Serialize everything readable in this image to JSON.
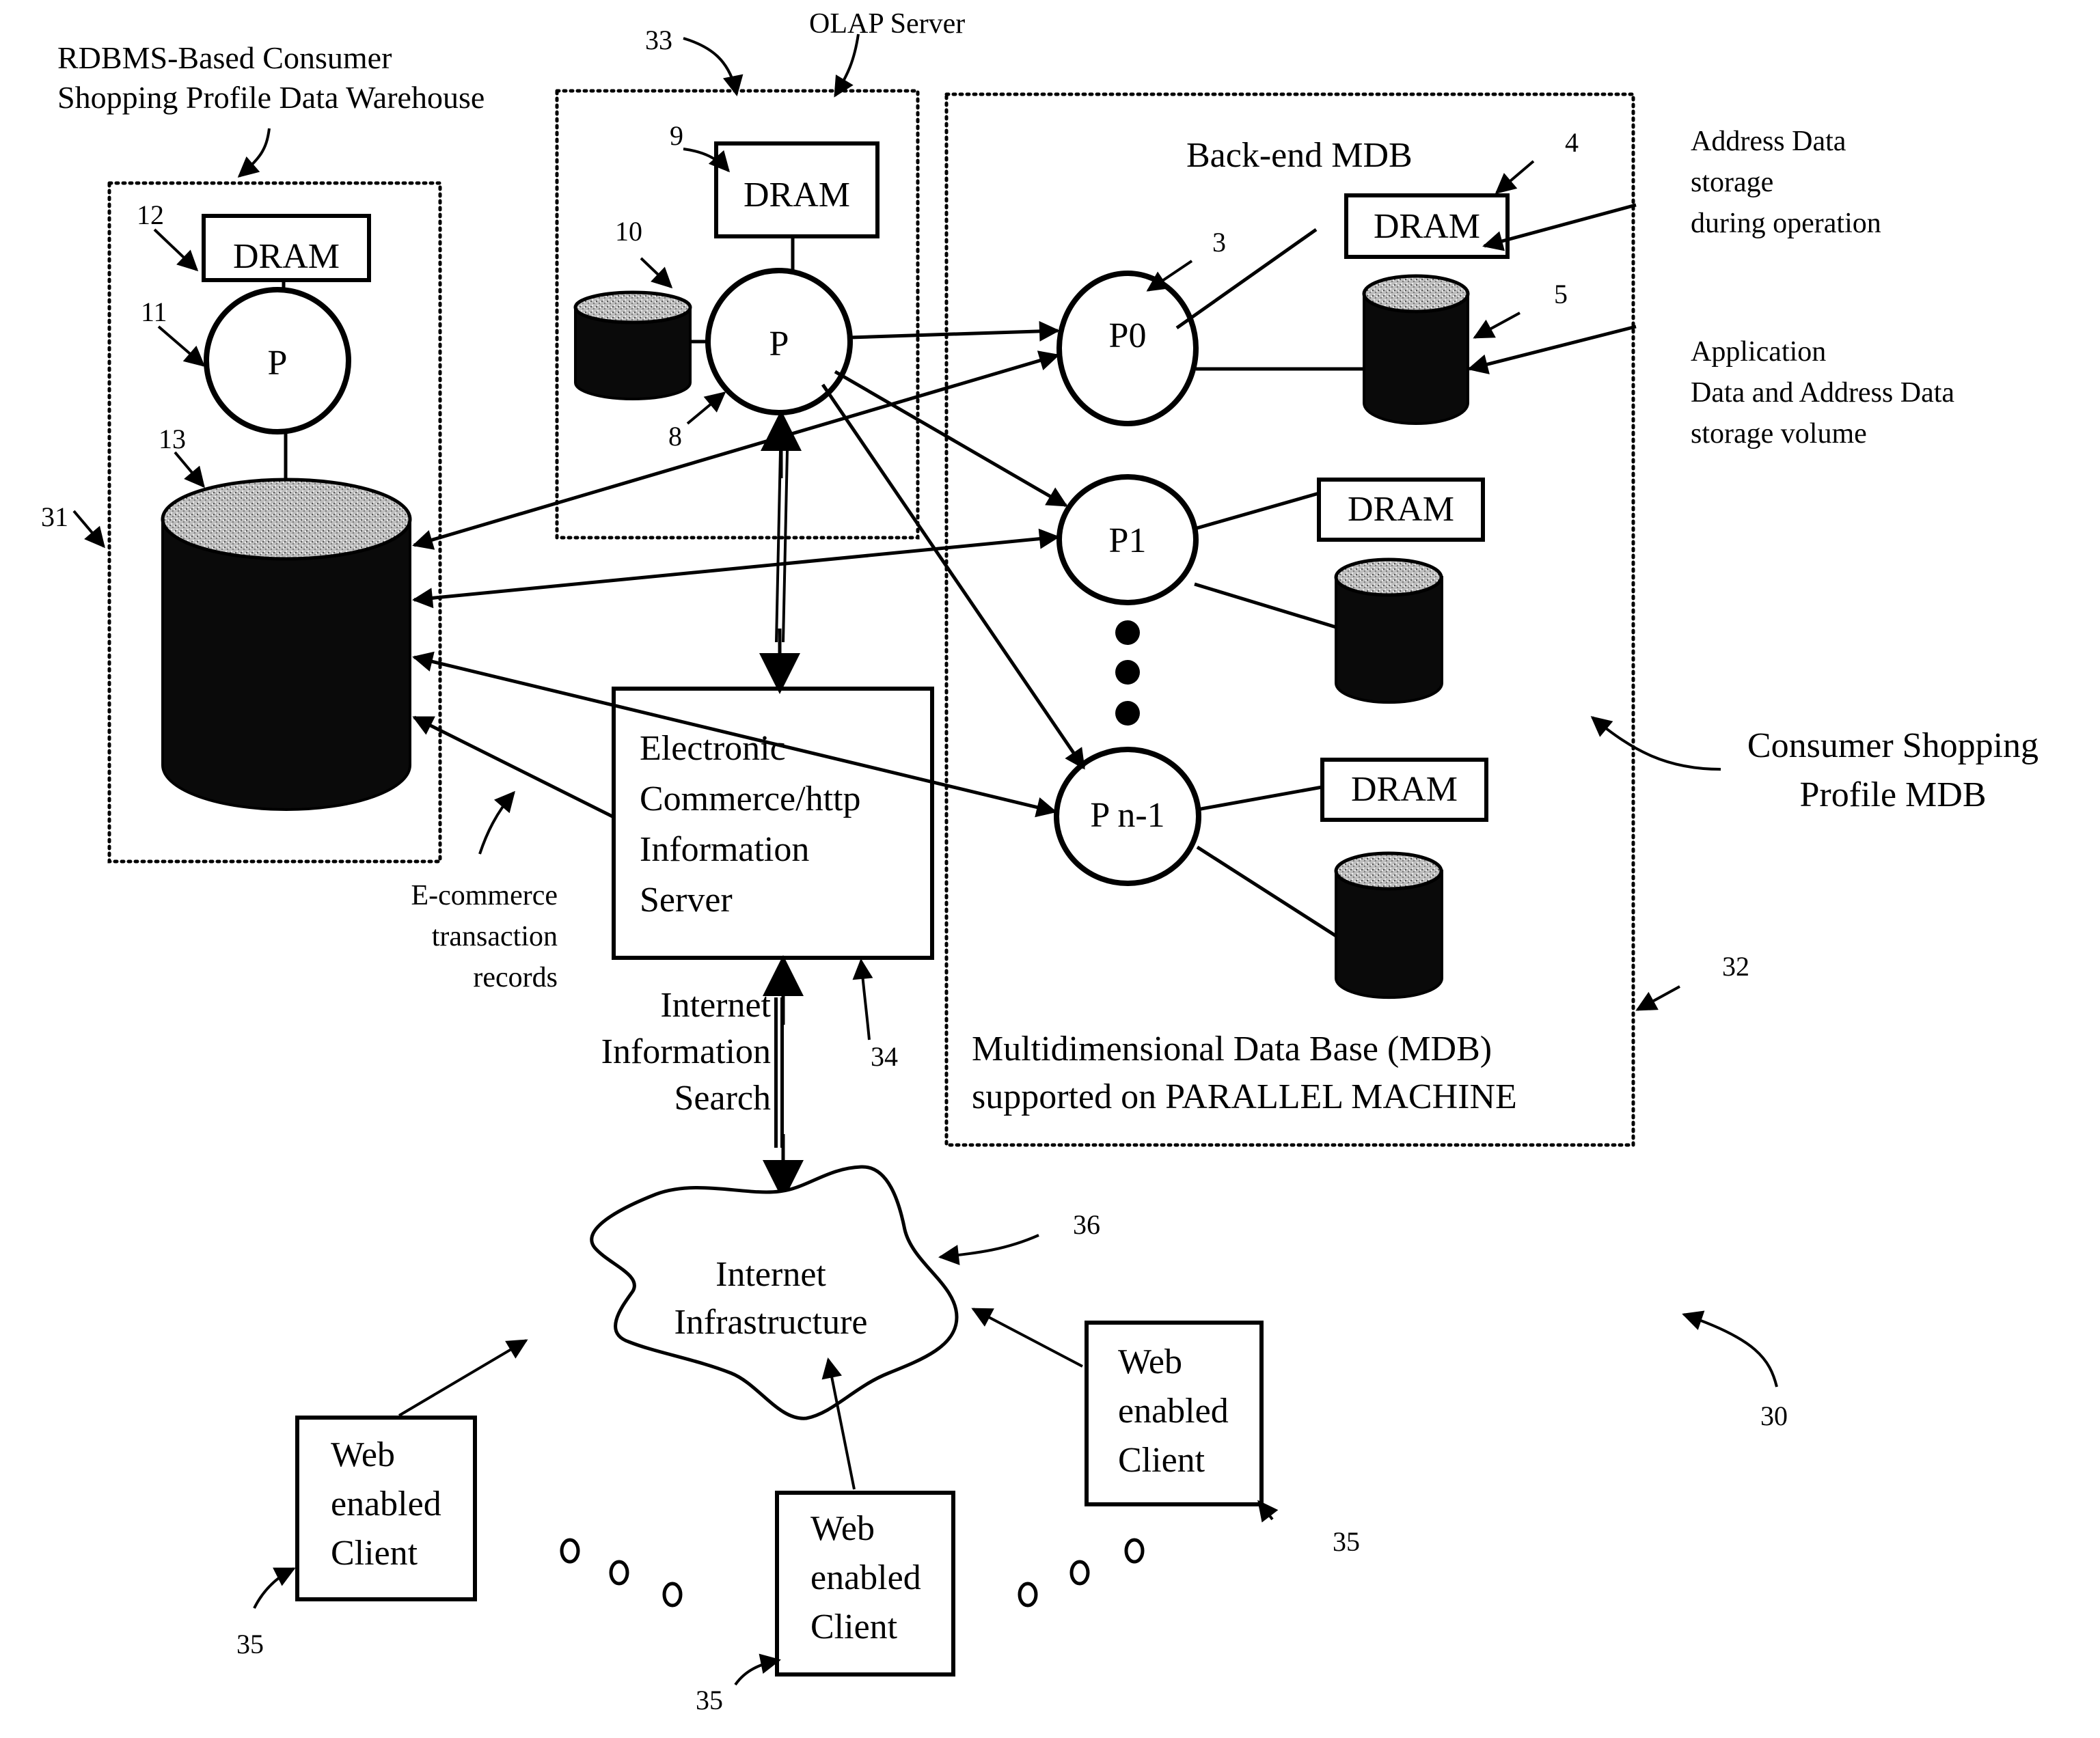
{
  "figure": {
    "ref_system": "30",
    "warehouse": {
      "title_lines": [
        "RDBMS-Based Consumer",
        "Shopping Profile Data Warehouse"
      ],
      "ref_box": "31",
      "dram_label": "DRAM",
      "dram_ref": "12",
      "proc_label": "P",
      "proc_ref": "11",
      "storage_ref": "13"
    },
    "olap": {
      "title": "OLAP  Server",
      "ref_box": "33",
      "dram_label": "DRAM",
      "dram_ref": "9",
      "proc_label": "P",
      "proc_ref": "8",
      "storage_ref": "10"
    },
    "mdb": {
      "backend_title": "Back-end MDB",
      "ref_box": "32",
      "footer_lines": [
        "Multidimensional Data Base (MDB)",
        "supported on PARALLEL MACHINE"
      ],
      "outer_label_lines": [
        "Consumer Shopping",
        "Profile MDB"
      ],
      "nodes": [
        {
          "label": "P0",
          "ref": "3",
          "dram_label": "DRAM",
          "dram_ref": "4",
          "storage_ref": "5"
        },
        {
          "label": "P1",
          "dram_label": "DRAM"
        },
        {
          "label": "P n-1",
          "dram_label": "DRAM"
        }
      ]
    },
    "annotations": {
      "address_data_lines": [
        "Address Data",
        "storage",
        "during operation"
      ],
      "application_data_lines": [
        "Application",
        "Data and Address Data",
        "storage volume"
      ],
      "ecommerce_records_lines": [
        "E-commerce",
        "transaction",
        "records"
      ],
      "internet_search_lines": [
        "Internet",
        "Information",
        "Search"
      ]
    },
    "ec_server": {
      "label_lines": [
        "Electronic",
        "Commerce/http",
        "Information",
        "Server"
      ],
      "ref": "34"
    },
    "internet": {
      "label_lines": [
        "Internet",
        "Infrastructure"
      ],
      "ref": "36"
    },
    "clients": [
      {
        "label_lines": [
          "Web",
          "enabled",
          "Client"
        ],
        "ref": "35"
      },
      {
        "label_lines": [
          "Web",
          "enabled",
          "Client"
        ],
        "ref": "35"
      },
      {
        "label_lines": [
          "Web",
          "enabled",
          "Client"
        ],
        "ref": "35"
      }
    ]
  }
}
